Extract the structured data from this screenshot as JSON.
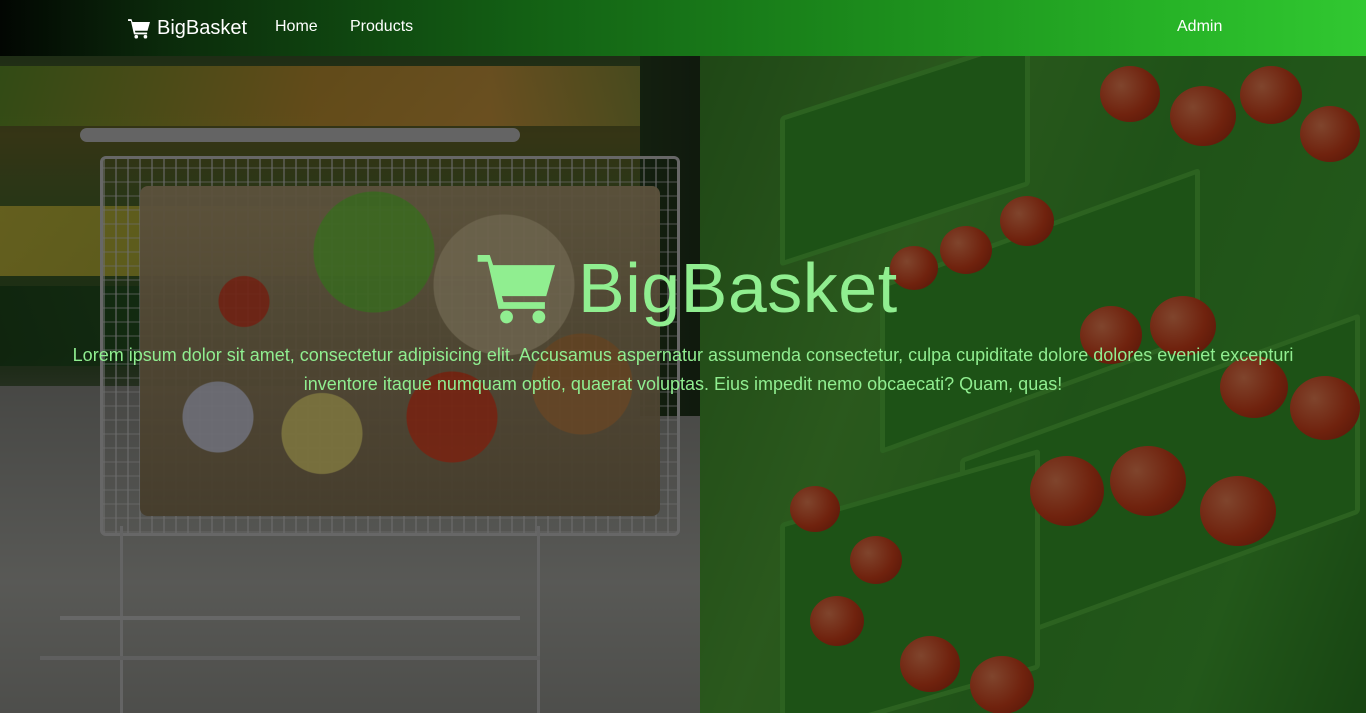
{
  "navbar": {
    "brand": "BigBasket",
    "brand_icon": "shopping-cart-icon",
    "links": {
      "home": "Home",
      "products": "Products"
    },
    "admin": "Admin"
  },
  "hero": {
    "title": "BigBasket",
    "title_icon": "shopping-cart-icon",
    "description": "Lorem ipsum dolor sit amet, consectetur adipisicing elit. Accusamus aspernatur assumenda consectetur, culpa cupiditate dolore dolores eveniet excepturi inventore itaque numquam optio, quaerat voluptas. Eius impedit nemo obcaecati? Quam, quas!",
    "text_color": "#90ee90"
  },
  "colors": {
    "nav_gradient_start": "#020602",
    "nav_gradient_end": "#31c831",
    "accent_text": "#90ee90"
  }
}
